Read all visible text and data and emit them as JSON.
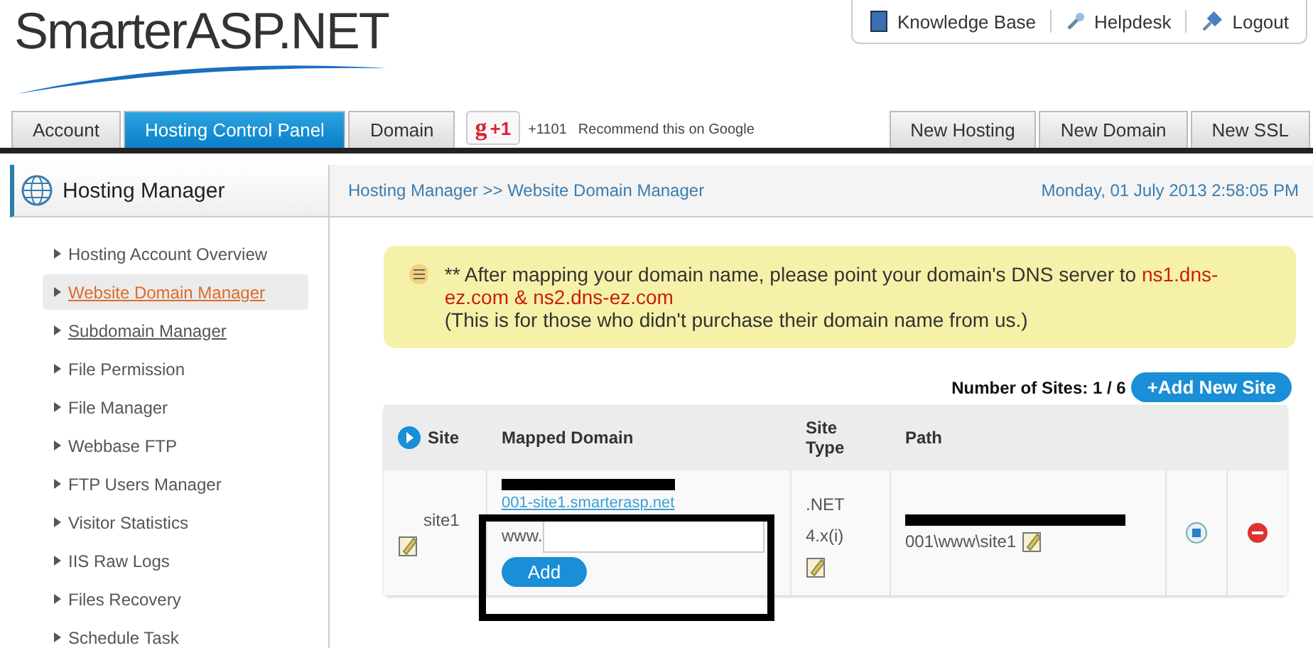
{
  "logo": {
    "text": "SmarterASP.NET"
  },
  "top_links": [
    {
      "label": "Knowledge Base"
    },
    {
      "label": "Helpdesk"
    },
    {
      "label": "Logout"
    }
  ],
  "tabs": [
    {
      "label": "Account",
      "selected": false
    },
    {
      "label": "Hosting Control Panel",
      "selected": true
    },
    {
      "label": "Domain",
      "selected": false
    }
  ],
  "social": {
    "letter": "g",
    "button": "+1",
    "count": "+1101",
    "text": "Recommend this on Google"
  },
  "right_tabs": [
    "New Hosting",
    "New Domain",
    "New SSL"
  ],
  "sidebar": {
    "title": "Hosting Manager",
    "items": [
      {
        "label": "Hosting Account Overview",
        "selected": false,
        "underlined": false
      },
      {
        "label": "Website Domain Manager",
        "selected": true,
        "underlined": true
      },
      {
        "label": "Subdomain Manager",
        "selected": false,
        "underlined": true
      },
      {
        "label": "File Permission",
        "selected": false,
        "underlined": false
      },
      {
        "label": "File Manager",
        "selected": false,
        "underlined": false
      },
      {
        "label": "Webbase FTP",
        "selected": false,
        "underlined": false
      },
      {
        "label": "FTP Users Manager",
        "selected": false,
        "underlined": false
      },
      {
        "label": "Visitor Statistics",
        "selected": false,
        "underlined": false
      },
      {
        "label": "IIS Raw Logs",
        "selected": false,
        "underlined": false
      },
      {
        "label": "Files Recovery",
        "selected": false,
        "underlined": false
      },
      {
        "label": "Schedule Task",
        "selected": false,
        "underlined": false
      }
    ]
  },
  "breadcrumb": "Hosting Manager >> Website Domain Manager",
  "datetime": "Monday, 01 July 2013 2:58:05 PM",
  "notice": {
    "text": "** After mapping your domain name, please point your domain's DNS server to ",
    "highlight": "ns1.dns-ez.com & ns2.dns-ez.com",
    "note": "(This is for those who didn't purchase their domain name from us.)"
  },
  "sites_count": {
    "label": "Number of Sites: 1 / 6",
    "button": "+Add New Site"
  },
  "table": {
    "columns": [
      "Site",
      "Mapped Domain",
      "Site Type",
      "Path"
    ],
    "rows": [
      {
        "site": "site1",
        "domain": "001-site1.smarterasp.net",
        "prefix": "www.",
        "add_button": "Add",
        "type": ".NET 4.x(i)",
        "path": "001\\www\\site1"
      }
    ]
  }
}
